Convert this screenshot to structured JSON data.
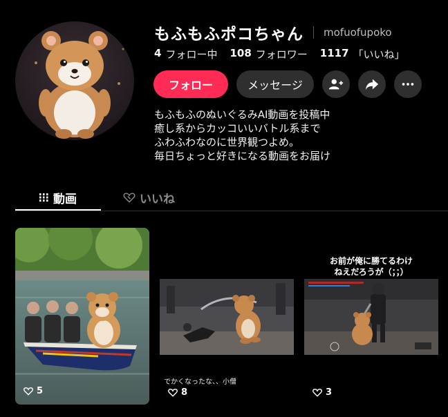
{
  "profile": {
    "display_name": "もふもふポコちゃん",
    "username": "mofuofupoko"
  },
  "stats": [
    {
      "value": "4",
      "label": "フォロー中"
    },
    {
      "value": "108",
      "label": "フォロワー"
    },
    {
      "value": "1117",
      "label": "「いいね」"
    }
  ],
  "actions": {
    "follow_label": "フォロー",
    "message_label": "メッセージ"
  },
  "bio": [
    "もふもふのぬいぐるみAI動画を投稿中",
    "癒し系からカッコいいバトル系まで",
    "ふわふわなのに世界観つよめ。",
    "毎日ちょっと好きになる動画をお届け"
  ],
  "tabs": {
    "videos_label": "動画",
    "likes_label": "いいね"
  },
  "videos": [
    {
      "likes": "5",
      "caption": "",
      "overlay": []
    },
    {
      "likes": "8",
      "caption": "でかくなったな、、小僧",
      "overlay": []
    },
    {
      "likes": "3",
      "caption": "",
      "overlay": [
        "お前が俺に勝てるわけ",
        "ねえだろうが（；；）"
      ]
    }
  ],
  "colors": {
    "background": "#000000",
    "accent": "#fe2c55",
    "button_secondary": "#2f2f2f",
    "muted_text": "#8a8a8a"
  },
  "icons": [
    "add-user-icon",
    "share-icon",
    "more-icon",
    "grid-icon",
    "heart-outline-icon",
    "heart-icon"
  ]
}
